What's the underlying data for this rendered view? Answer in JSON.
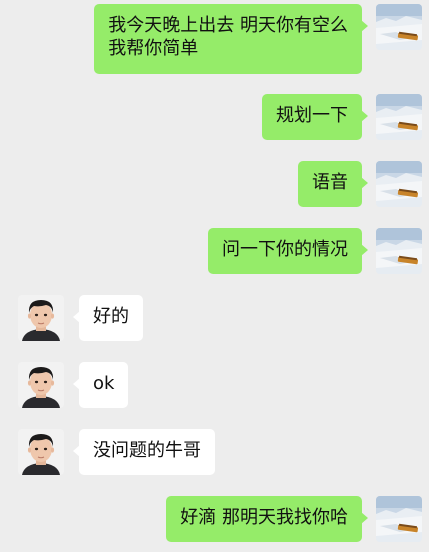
{
  "colors": {
    "background": "#EDEDED",
    "outgoing_bubble": "#95EC69",
    "incoming_bubble": "#FFFFFF",
    "text": "#111111"
  },
  "icons": {
    "self_avatar": "snow-train-photo-avatar",
    "contact_avatar": "boy-portrait-avatar"
  },
  "messages": [
    {
      "direction": "outgoing",
      "lines": [
        "我今天晚上出去 明天你有空么",
        "我帮你简单"
      ]
    },
    {
      "direction": "outgoing",
      "text": "规划一下"
    },
    {
      "direction": "outgoing",
      "text": "语音"
    },
    {
      "direction": "outgoing",
      "text": "问一下你的情况"
    },
    {
      "direction": "incoming",
      "text": "好的"
    },
    {
      "direction": "incoming",
      "text": "ok"
    },
    {
      "direction": "incoming",
      "text": "没问题的牛哥"
    },
    {
      "direction": "outgoing",
      "text": "好滴 那明天我找你哈"
    }
  ]
}
